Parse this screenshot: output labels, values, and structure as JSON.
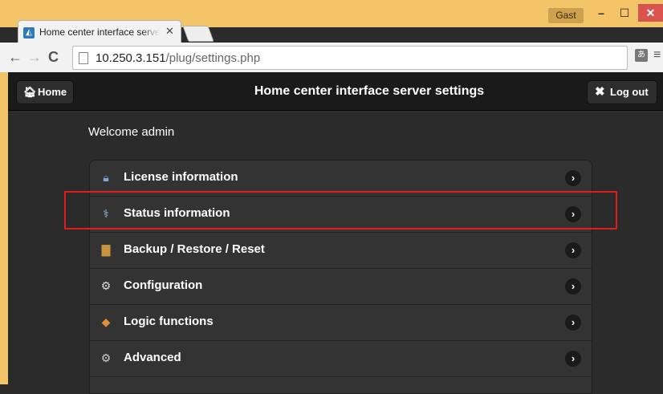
{
  "browser": {
    "user_badge": "Gast",
    "window_controls": {
      "minimize": "–",
      "maximize": "☐",
      "close": "✕"
    },
    "tab": {
      "title": "Home center interface server settings",
      "close": "✕"
    },
    "nav": {
      "back": "←",
      "forward": "→",
      "reload": "C"
    },
    "url": {
      "host": "10.250.3.151",
      "path": "/plug/settings.php"
    },
    "menu_glyph": "≡"
  },
  "app": {
    "header": {
      "home_label": "Home",
      "title": "Home center interface server settings",
      "logout_label": "Log out"
    },
    "welcome": "Welcome admin",
    "menu_items": [
      {
        "label": "License information",
        "icon": "license-icon"
      },
      {
        "label": "Status information",
        "icon": "stethoscope-icon"
      },
      {
        "label": "Backup / Restore / Reset",
        "icon": "backup-icon"
      },
      {
        "label": "Configuration",
        "icon": "gear-icon"
      },
      {
        "label": "Logic functions",
        "icon": "logic-icon"
      },
      {
        "label": "Advanced",
        "icon": "advanced-gears-icon"
      }
    ],
    "highlighted_item": "Status information"
  }
}
